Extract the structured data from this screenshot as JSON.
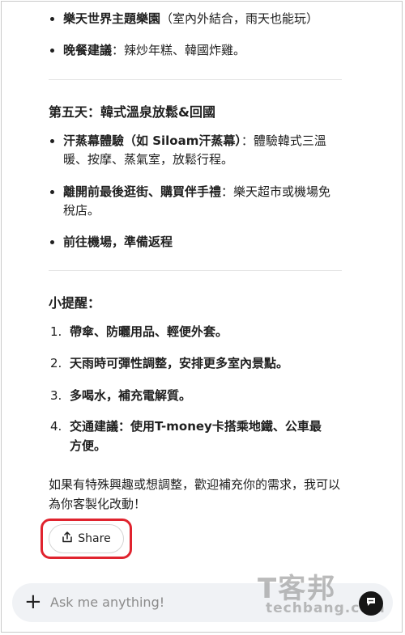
{
  "items_top": [
    {
      "bold": "樂天世界主題樂園",
      "rest": "（室內外結合，雨天也能玩）"
    },
    {
      "bold": "晚餐建議",
      "rest": "：辣炒年糕、韓國炸雞。"
    }
  ],
  "day5": {
    "title": "第五天：韓式溫泉放鬆&回國",
    "items": [
      {
        "bold": "汗蒸幕體驗（如 Siloam汗蒸幕）",
        "rest": "：體驗韓式三溫暖、按摩、蒸氣室，放鬆行程。"
      },
      {
        "bold": "離開前最後逛街、購買伴手禮",
        "rest": "：樂天超市或機場免稅店。"
      },
      {
        "bold": "前往機場，準備返程",
        "rest": ""
      }
    ]
  },
  "tips": {
    "title": "小提醒：",
    "items": [
      {
        "num": "1.",
        "text": "帶傘、防曬用品、輕便外套。"
      },
      {
        "num": "2.",
        "text": "天雨時可彈性調整，安排更多室內景點。"
      },
      {
        "num": "3.",
        "text": "多喝水，補充電解質。"
      },
      {
        "num": "4.",
        "text": "交通建議：使用T-money卡搭乘地鐵、公車最方便。"
      }
    ]
  },
  "closing": "如果有特殊興趣或想調整，歡迎補充你的需求，我可以為你客製化改動！",
  "share_label": "Share",
  "chat": {
    "placeholder": "Ask me anything!"
  },
  "watermark": {
    "big": "T客邦",
    "small": "techbang.com"
  },
  "colors": {
    "highlight": "#e0232e",
    "chat_bg": "#f0f2f5"
  }
}
